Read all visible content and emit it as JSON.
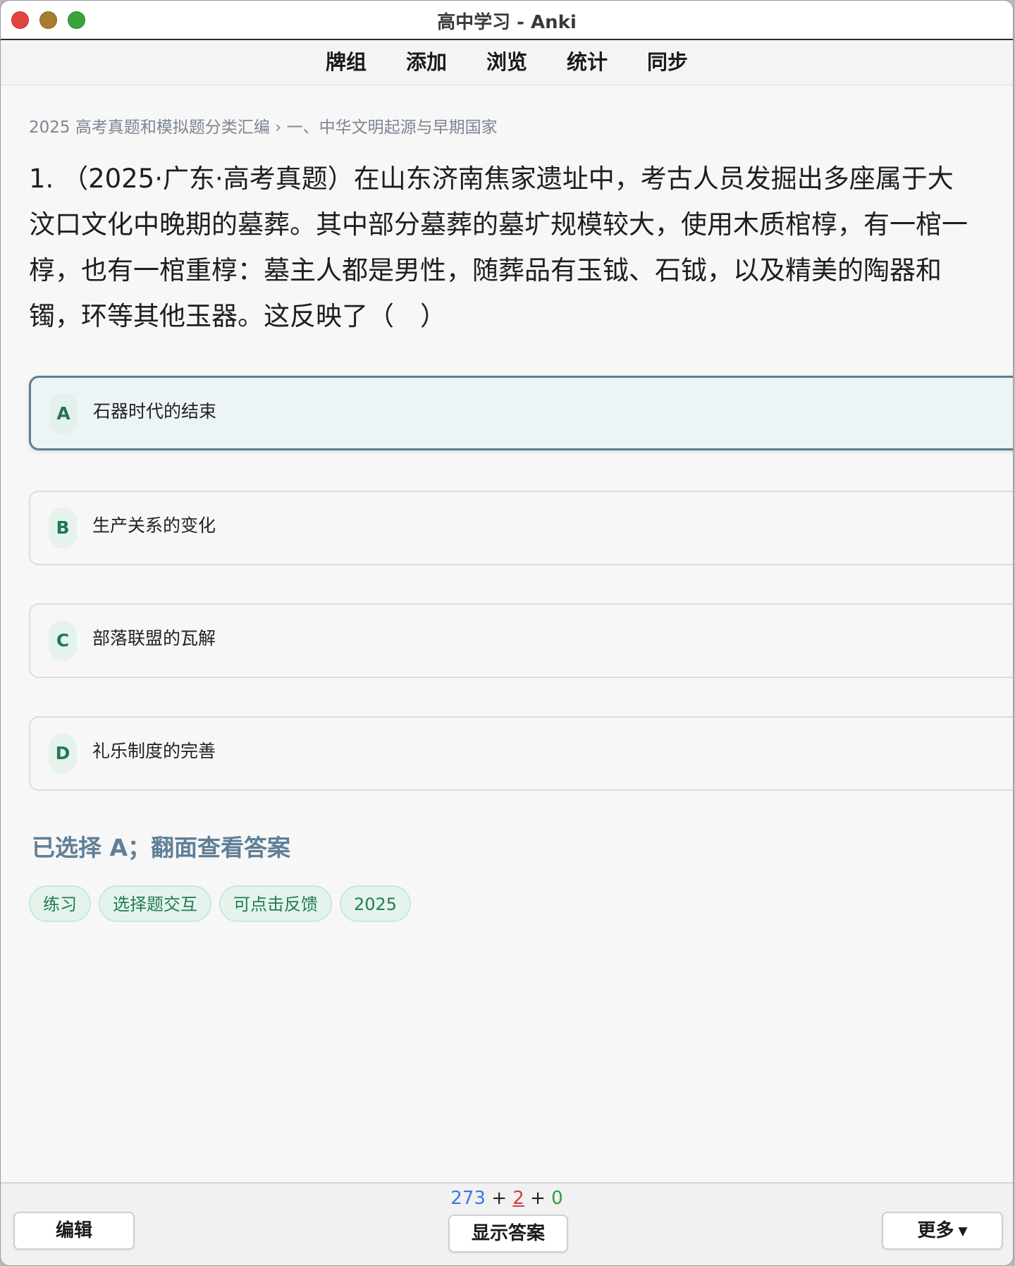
{
  "window": {
    "title": "高中学习 - Anki"
  },
  "nav": {
    "items": [
      "牌组",
      "添加",
      "浏览",
      "统计",
      "同步"
    ]
  },
  "card": {
    "breadcrumb": "2025 高考真题和模拟题分类汇编 › 一、中华文明起源与早期国家",
    "question": "1. （2025·广东·高考真题）在山东济南焦家遗址中，考古人员发掘出多座属于大汶口文化中晚期的墓葬。其中部分墓葬的墓圹规模较大，使用木质棺椁，有一棺一椁，也有一棺重椁：墓主人都是男性，随葬品有玉钺、石钺，以及精美的陶器和镯，环等其他玉器。这反映了（　）",
    "options": [
      {
        "letter": "A",
        "text": "石器时代的结束",
        "selected": true
      },
      {
        "letter": "B",
        "text": "生产关系的变化",
        "selected": false
      },
      {
        "letter": "C",
        "text": "部落联盟的瓦解",
        "selected": false
      },
      {
        "letter": "D",
        "text": "礼乐制度的完善",
        "selected": false
      }
    ],
    "status": "已选择 A；翻面查看答案",
    "tags": [
      "练习",
      "选择题交互",
      "可点击反馈",
      "2025"
    ]
  },
  "bottom": {
    "edit_label": "编辑",
    "show_answer_label": "显示答案",
    "more_label": "更多",
    "more_icon": "caret-down-icon",
    "counts": {
      "new": "273",
      "plus1": "+",
      "learn": "2",
      "plus2": "+",
      "review": "0"
    }
  },
  "colors": {
    "new": "#3b78e7",
    "learn": "#d43b3b",
    "review": "#2a9d44",
    "accent": "#5c7f93",
    "tag_bg": "#e4f4ec",
    "tag_text": "#237a56"
  }
}
